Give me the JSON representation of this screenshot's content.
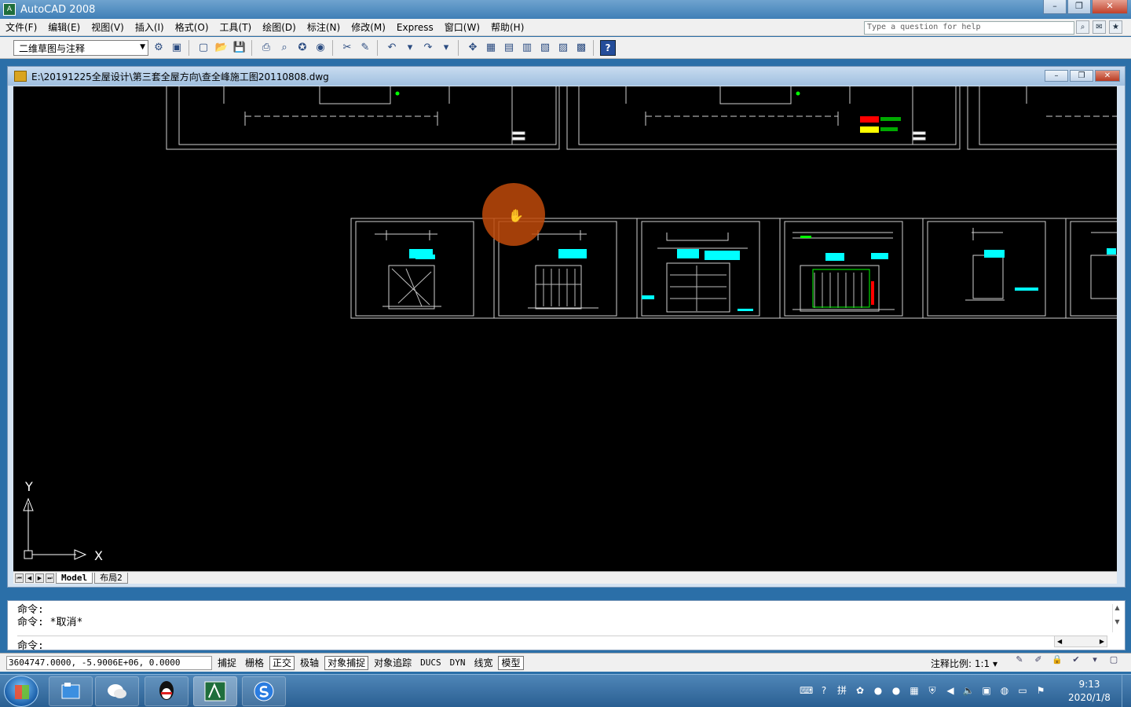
{
  "app": {
    "title": "AutoCAD 2008",
    "logo_text": "A"
  },
  "window_controls": {
    "minimize": "–",
    "restore": "❐",
    "close": "✕"
  },
  "menu": [
    "文件(F)",
    "编辑(E)",
    "视图(V)",
    "插入(I)",
    "格式(O)",
    "工具(T)",
    "绘图(D)",
    "标注(N)",
    "修改(M)",
    "Express",
    "窗口(W)",
    "帮助(H)"
  ],
  "help_search": {
    "placeholder": "Type a question for help"
  },
  "toolbar": {
    "workspace": "二维草图与注释",
    "help_label": "?"
  },
  "document": {
    "title": "E:\\20191225全屋设计\\第三套全屋方向\\查全峰施工图20110808.dwg"
  },
  "ucs": {
    "x_label": "X",
    "y_label": "Y"
  },
  "layout_tabs": [
    "Model",
    "布局2"
  ],
  "command": {
    "history": [
      "命令:",
      "命令: *取消*"
    ],
    "prompt": "命令:"
  },
  "status": {
    "coords": "3604747.0000, -5.9006E+06, 0.0000",
    "toggles": [
      {
        "label": "捕捉",
        "on": false
      },
      {
        "label": "栅格",
        "on": false
      },
      {
        "label": "正交",
        "on": true
      },
      {
        "label": "极轴",
        "on": false
      },
      {
        "label": "对象捕捉",
        "on": true
      },
      {
        "label": "对象追踪",
        "on": false
      },
      {
        "label": "DUCS",
        "on": false
      },
      {
        "label": "DYN",
        "on": false
      },
      {
        "label": "线宽",
        "on": false
      },
      {
        "label": "模型",
        "on": true
      }
    ],
    "annotation_scale_label": "注释比例:",
    "annotation_scale_value": "1:1"
  },
  "taskbar": {
    "apps": [
      "file-explorer",
      "wechat",
      "qq",
      "autocad",
      "sogou"
    ],
    "clock_time": "9:13",
    "clock_date": "2020/1/8"
  },
  "colors": {
    "canvas": "#000000",
    "cyan": "#00ffff",
    "red": "#ff0000",
    "yellow": "#ffff00",
    "green": "#00ff00",
    "cursor_halo": "#c04a0a"
  }
}
